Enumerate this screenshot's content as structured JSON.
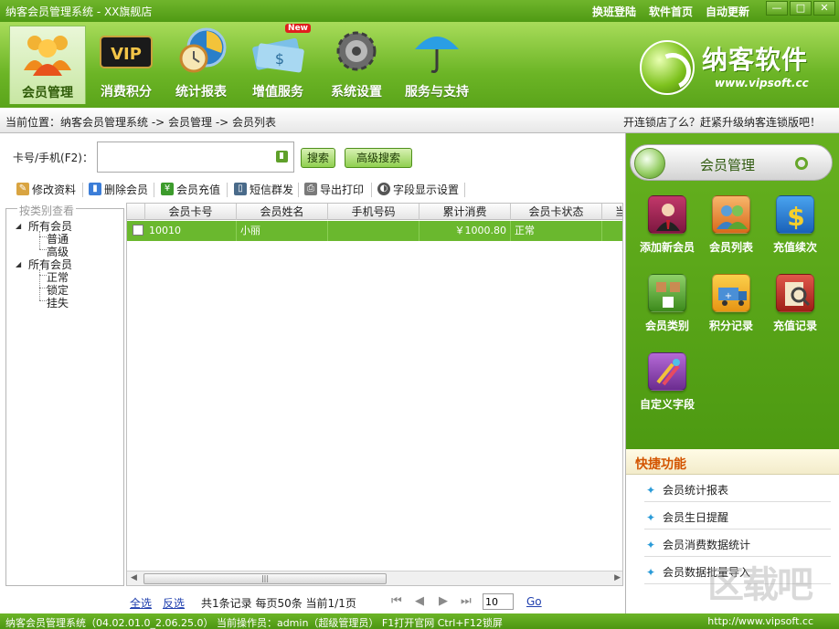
{
  "titlebar": {
    "title": "纳客会员管理系统 - XX旗舰店",
    "links": [
      "换班登陆",
      "软件首页",
      "自动更新"
    ],
    "min": "—",
    "max": "□",
    "close": "✕"
  },
  "nav": {
    "items": [
      "会员管理",
      "消费积分",
      "统计报表",
      "增值服务",
      "系统设置",
      "服务与支持"
    ],
    "vip_text": "VIP",
    "new_badge": "New"
  },
  "logo": {
    "brand": "纳客软件",
    "url": "www.vipsoft.cc"
  },
  "breadcrumb": {
    "text": "当前位置：纳客会员管理系统 -> 会员管理 -> 会员列表",
    "promo": "开连锁店了么？赶紧升级纳客连锁版吧！"
  },
  "search": {
    "label": "卡号/手机(F2)：",
    "value": "",
    "search_btn": "搜索",
    "adv_btn": "高级搜索"
  },
  "toolbar": [
    "修改资料",
    "删除会员",
    "会员充值",
    "短信群发",
    "导出打印",
    "字段显示设置"
  ],
  "tree": {
    "legend": "按类别查看",
    "group1": "所有会员",
    "group1_children": [
      "普通",
      "高级"
    ],
    "group2": "所有会员",
    "group2_children": [
      "正常",
      "锁定",
      "挂失"
    ]
  },
  "grid": {
    "columns": [
      "会员卡号",
      "会员姓名",
      "手机号码",
      "累计消费",
      "会员卡状态",
      "当"
    ],
    "rows": [
      {
        "card": "10010",
        "name": "小丽",
        "phone": "",
        "total": "￥1000.80",
        "status": "正常"
      }
    ]
  },
  "pager": {
    "select_all": "全选",
    "invert": "反选",
    "info": "共1条记录  每页50条  当前1/1页",
    "page_input": "10",
    "go": "Go"
  },
  "right": {
    "header": "会员管理",
    "tiles": [
      "添加新会员",
      "会员列表",
      "充值续次",
      "会员类别",
      "积分记录",
      "充值记录",
      "自定义字段"
    ],
    "quick_title": "快捷功能",
    "quick_items": [
      "会员统计报表",
      "会员生日提醒",
      "会员消费数据统计",
      "会员数据批量导入"
    ]
  },
  "statusbar": {
    "text": "纳客会员管理系统（04.02.01.0_2.06.25.0）  当前操作员：admin（超级管理员） F1打开官网 Ctrl+F12锁屏",
    "url": "http://www.vipsoft.cc"
  },
  "watermark": "区载吧"
}
